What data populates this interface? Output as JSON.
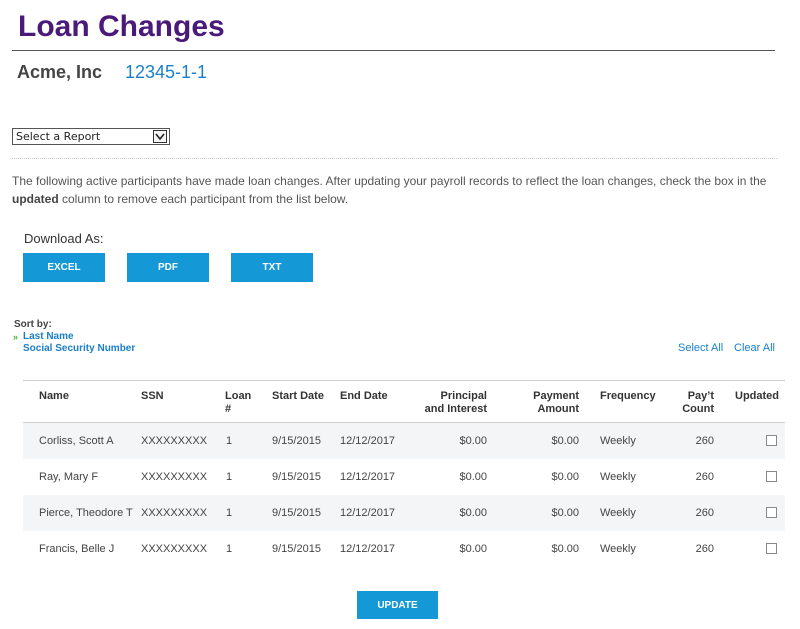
{
  "header": {
    "title": "Loan Changes",
    "company_name": "Acme, Inc",
    "company_id": "12345-1-1"
  },
  "report_select": {
    "selected": "Select a Report"
  },
  "intro": {
    "part1": "The following active participants have made loan changes. After updating your payroll records to reflect the loan changes, check the box in the ",
    "bold": "updated",
    "part2": " column to remove each participant from the list below."
  },
  "download": {
    "label": "Download As:",
    "buttons": [
      "EXCEL",
      "PDF",
      "TXT"
    ]
  },
  "sort": {
    "label": "Sort by:",
    "arrow": "»",
    "options": [
      "Last Name",
      "Social Security Number"
    ]
  },
  "selection": {
    "select_all": "Select All",
    "clear_all": "Clear All"
  },
  "table": {
    "headers": {
      "name": "Name",
      "ssn": "SSN",
      "loan_1": "Loan",
      "loan_2": "#",
      "start_date": "Start Date",
      "end_date": "End Date",
      "principal_1": "Principal",
      "principal_2": "and Interest",
      "payment_1": "Payment",
      "payment_2": "Amount",
      "frequency": "Frequency",
      "payt_1": "Pay’t",
      "payt_2": "Count",
      "updated": "Updated"
    },
    "rows": [
      {
        "name": "Corliss, Scott A",
        "ssn": "XXXXXXXXX",
        "loan": "1",
        "start": "9/15/2015",
        "end": "12/12/2017",
        "principal": "$0.00",
        "payment": "$0.00",
        "frequency": "Weekly",
        "count": "260",
        "updated": false
      },
      {
        "name": "Ray, Mary F",
        "ssn": "XXXXXXXXX",
        "loan": "1",
        "start": "9/15/2015",
        "end": "12/12/2017",
        "principal": "$0.00",
        "payment": "$0.00",
        "frequency": "Weekly",
        "count": "260",
        "updated": false
      },
      {
        "name": "Pierce, Theodore T",
        "ssn": "XXXXXXXXX",
        "loan": "1",
        "start": "9/15/2015",
        "end": "12/12/2017",
        "principal": "$0.00",
        "payment": "$0.00",
        "frequency": "Weekly",
        "count": "260",
        "updated": false
      },
      {
        "name": "Francis, Belle J",
        "ssn": "XXXXXXXXX",
        "loan": "1",
        "start": "9/15/2015",
        "end": "12/12/2017",
        "principal": "$0.00",
        "payment": "$0.00",
        "frequency": "Weekly",
        "count": "260",
        "updated": false
      }
    ]
  },
  "actions": {
    "update_label": "UPDATE"
  },
  "colors": {
    "title": "#4a1a7a",
    "link": "#1a7fc9",
    "button": "#1499d6",
    "sort_arrow": "#4cae2f"
  }
}
